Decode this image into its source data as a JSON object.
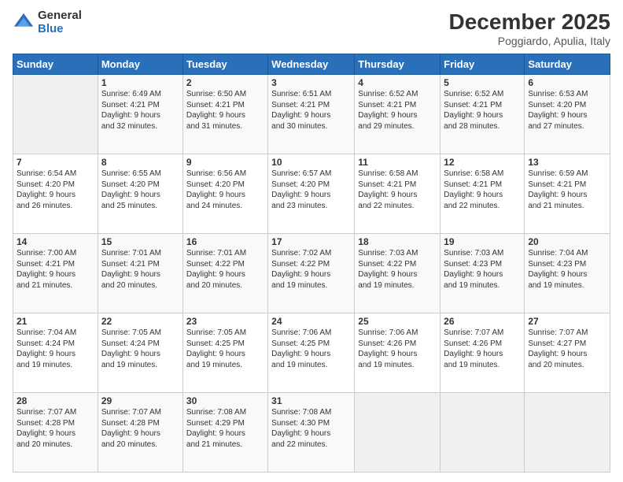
{
  "logo": {
    "general": "General",
    "blue": "Blue"
  },
  "header": {
    "month": "December 2025",
    "location": "Poggiardo, Apulia, Italy"
  },
  "days_of_week": [
    "Sunday",
    "Monday",
    "Tuesday",
    "Wednesday",
    "Thursday",
    "Friday",
    "Saturday"
  ],
  "weeks": [
    [
      {
        "day": "",
        "info": ""
      },
      {
        "day": "1",
        "info": "Sunrise: 6:49 AM\nSunset: 4:21 PM\nDaylight: 9 hours\nand 32 minutes."
      },
      {
        "day": "2",
        "info": "Sunrise: 6:50 AM\nSunset: 4:21 PM\nDaylight: 9 hours\nand 31 minutes."
      },
      {
        "day": "3",
        "info": "Sunrise: 6:51 AM\nSunset: 4:21 PM\nDaylight: 9 hours\nand 30 minutes."
      },
      {
        "day": "4",
        "info": "Sunrise: 6:52 AM\nSunset: 4:21 PM\nDaylight: 9 hours\nand 29 minutes."
      },
      {
        "day": "5",
        "info": "Sunrise: 6:52 AM\nSunset: 4:21 PM\nDaylight: 9 hours\nand 28 minutes."
      },
      {
        "day": "6",
        "info": "Sunrise: 6:53 AM\nSunset: 4:20 PM\nDaylight: 9 hours\nand 27 minutes."
      }
    ],
    [
      {
        "day": "7",
        "info": "Sunrise: 6:54 AM\nSunset: 4:20 PM\nDaylight: 9 hours\nand 26 minutes."
      },
      {
        "day": "8",
        "info": "Sunrise: 6:55 AM\nSunset: 4:20 PM\nDaylight: 9 hours\nand 25 minutes."
      },
      {
        "day": "9",
        "info": "Sunrise: 6:56 AM\nSunset: 4:20 PM\nDaylight: 9 hours\nand 24 minutes."
      },
      {
        "day": "10",
        "info": "Sunrise: 6:57 AM\nSunset: 4:20 PM\nDaylight: 9 hours\nand 23 minutes."
      },
      {
        "day": "11",
        "info": "Sunrise: 6:58 AM\nSunset: 4:21 PM\nDaylight: 9 hours\nand 22 minutes."
      },
      {
        "day": "12",
        "info": "Sunrise: 6:58 AM\nSunset: 4:21 PM\nDaylight: 9 hours\nand 22 minutes."
      },
      {
        "day": "13",
        "info": "Sunrise: 6:59 AM\nSunset: 4:21 PM\nDaylight: 9 hours\nand 21 minutes."
      }
    ],
    [
      {
        "day": "14",
        "info": "Sunrise: 7:00 AM\nSunset: 4:21 PM\nDaylight: 9 hours\nand 21 minutes."
      },
      {
        "day": "15",
        "info": "Sunrise: 7:01 AM\nSunset: 4:21 PM\nDaylight: 9 hours\nand 20 minutes."
      },
      {
        "day": "16",
        "info": "Sunrise: 7:01 AM\nSunset: 4:22 PM\nDaylight: 9 hours\nand 20 minutes."
      },
      {
        "day": "17",
        "info": "Sunrise: 7:02 AM\nSunset: 4:22 PM\nDaylight: 9 hours\nand 19 minutes."
      },
      {
        "day": "18",
        "info": "Sunrise: 7:03 AM\nSunset: 4:22 PM\nDaylight: 9 hours\nand 19 minutes."
      },
      {
        "day": "19",
        "info": "Sunrise: 7:03 AM\nSunset: 4:23 PM\nDaylight: 9 hours\nand 19 minutes."
      },
      {
        "day": "20",
        "info": "Sunrise: 7:04 AM\nSunset: 4:23 PM\nDaylight: 9 hours\nand 19 minutes."
      }
    ],
    [
      {
        "day": "21",
        "info": "Sunrise: 7:04 AM\nSunset: 4:24 PM\nDaylight: 9 hours\nand 19 minutes."
      },
      {
        "day": "22",
        "info": "Sunrise: 7:05 AM\nSunset: 4:24 PM\nDaylight: 9 hours\nand 19 minutes."
      },
      {
        "day": "23",
        "info": "Sunrise: 7:05 AM\nSunset: 4:25 PM\nDaylight: 9 hours\nand 19 minutes."
      },
      {
        "day": "24",
        "info": "Sunrise: 7:06 AM\nSunset: 4:25 PM\nDaylight: 9 hours\nand 19 minutes."
      },
      {
        "day": "25",
        "info": "Sunrise: 7:06 AM\nSunset: 4:26 PM\nDaylight: 9 hours\nand 19 minutes."
      },
      {
        "day": "26",
        "info": "Sunrise: 7:07 AM\nSunset: 4:26 PM\nDaylight: 9 hours\nand 19 minutes."
      },
      {
        "day": "27",
        "info": "Sunrise: 7:07 AM\nSunset: 4:27 PM\nDaylight: 9 hours\nand 20 minutes."
      }
    ],
    [
      {
        "day": "28",
        "info": "Sunrise: 7:07 AM\nSunset: 4:28 PM\nDaylight: 9 hours\nand 20 minutes."
      },
      {
        "day": "29",
        "info": "Sunrise: 7:07 AM\nSunset: 4:28 PM\nDaylight: 9 hours\nand 20 minutes."
      },
      {
        "day": "30",
        "info": "Sunrise: 7:08 AM\nSunset: 4:29 PM\nDaylight: 9 hours\nand 21 minutes."
      },
      {
        "day": "31",
        "info": "Sunrise: 7:08 AM\nSunset: 4:30 PM\nDaylight: 9 hours\nand 22 minutes."
      },
      {
        "day": "",
        "info": ""
      },
      {
        "day": "",
        "info": ""
      },
      {
        "day": "",
        "info": ""
      }
    ]
  ]
}
